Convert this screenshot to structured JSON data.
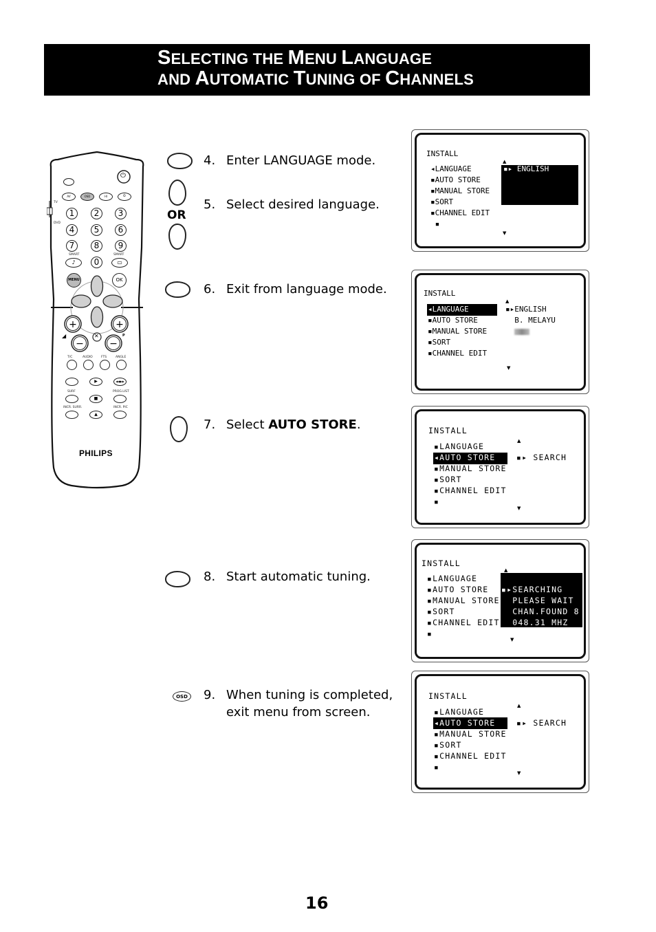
{
  "header": {
    "line1": [
      {
        "cap": "S",
        "rest": "ELECTING THE "
      },
      {
        "cap": "M",
        "rest": "ENU "
      },
      {
        "cap": "L",
        "rest": "ANGUAGE"
      }
    ],
    "line2": [
      {
        "cap": "",
        "rest": "AND "
      },
      {
        "cap": "A",
        "rest": "UTOMATIC "
      },
      {
        "cap": "T",
        "rest": "UNING OF "
      },
      {
        "cap": "C",
        "rest": "HANNELS"
      }
    ]
  },
  "steps": [
    {
      "number": "4.",
      "text": "Enter LANGUAGE mode.",
      "key": "right-cursor-key"
    },
    {
      "number": "5.",
      "text": "Select desired language.",
      "key": "up-down-cursor-keys",
      "or_label": "OR"
    },
    {
      "number": "6.",
      "text": "Exit from language mode.",
      "key": "left-cursor-key"
    },
    {
      "number": "7.",
      "text_before": "Select ",
      "text_bold": "AUTO STORE",
      "text_after": ".",
      "key": "down-cursor-key"
    },
    {
      "number": "8.",
      "text": "Start automatic tuning.",
      "key": "right-cursor-key"
    },
    {
      "number": "9.",
      "text": "When tuning is completed,\nexit menu from screen.",
      "key": "osd-key",
      "key_label": "OSD"
    }
  ],
  "screens": [
    {
      "title": "INSTALL",
      "menu": [
        "LANGUAGE",
        "AUTO STORE",
        "MANUAL STORE",
        "SORT",
        "CHANNEL EDIT"
      ],
      "active_item": "LANGUAGE",
      "right_panel": [
        "ENGLISH"
      ]
    },
    {
      "title": "INSTALL",
      "menu": [
        "LANGUAGE",
        "AUTO STORE",
        "MANUAL STORE",
        "SORT",
        "CHANNEL EDIT"
      ],
      "active_item": "LANGUAGE",
      "right_panel": [
        "ENGLISH",
        "B. MELAYU",
        "中文"
      ]
    },
    {
      "title": "INSTALL",
      "menu": [
        "LANGUAGE",
        "AUTO STORE",
        "MANUAL STORE",
        "SORT",
        "CHANNEL EDIT"
      ],
      "active_item": "AUTO STORE",
      "right_panel": [
        "SEARCH"
      ]
    },
    {
      "title": "INSTALL",
      "menu": [
        "LANGUAGE",
        "AUTO STORE",
        "MANUAL STORE",
        "SORT",
        "CHANNEL EDIT"
      ],
      "active_item": "AUTO STORE",
      "right_panel": [
        "SEARCHING",
        "PLEASE WAIT",
        "CHAN.FOUND 8",
        "048.31 MHZ"
      ]
    },
    {
      "title": "INSTALL",
      "menu": [
        "LANGUAGE",
        "AUTO STORE",
        "MANUAL STORE",
        "SORT",
        "CHANNEL EDIT"
      ],
      "active_item": "AUTO STORE",
      "right_panel": [
        "SEARCH"
      ]
    }
  ],
  "remote": {
    "brand": "PHILIPS",
    "switch_labels": [
      "TV",
      "DVD"
    ],
    "top_buttons": [
      "AV",
      "OSD",
      "I-II",
      "⏲"
    ],
    "numbers": [
      "1",
      "2",
      "3",
      "4",
      "5",
      "6",
      "7",
      "8",
      "9",
      "♪",
      "0",
      "▭"
    ],
    "smart_labels": [
      "SMART",
      "SMART"
    ],
    "nav_buttons": [
      "MENU",
      "OK"
    ],
    "volume_label": "◢",
    "program_label": "P",
    "row_labels_1": [
      "T/C",
      "AUDIO",
      "FTS",
      "ANGLE"
    ],
    "row_labels_3": [
      "SURF",
      "",
      "PROG.LIST"
    ],
    "row_labels_4": [
      "INCR. SURR.",
      "",
      "INCR. PIC"
    ]
  },
  "page_number": "16"
}
